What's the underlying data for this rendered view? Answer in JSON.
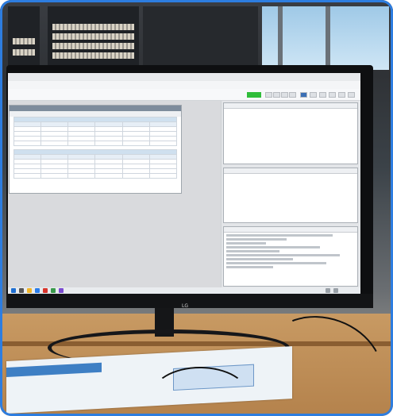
{
  "monitor": {
    "brand": "LG"
  },
  "app": {
    "menu": [
      "",
      "",
      ""
    ],
    "panel": {
      "table1": {
        "caption": "",
        "headers": [
          "",
          "",
          "",
          "",
          "",
          ""
        ],
        "rows": [
          [
            "",
            "",
            "",
            "",
            "",
            ""
          ],
          [
            "",
            "",
            "",
            "",
            "",
            ""
          ],
          [
            "",
            "",
            "",
            "",
            "",
            ""
          ],
          [
            "",
            "",
            "",
            "",
            "",
            ""
          ]
        ]
      },
      "table2": {
        "caption": "",
        "headers": [
          "",
          "",
          "",
          "",
          "",
          ""
        ],
        "rows": [
          [
            "",
            "",
            "",
            "",
            "",
            ""
          ],
          [
            "",
            "",
            "",
            "",
            "",
            ""
          ],
          [
            "",
            "",
            "",
            "",
            "",
            ""
          ],
          [
            "",
            "",
            "",
            "",
            "",
            ""
          ]
        ]
      }
    }
  },
  "colors": {
    "frame_border": "#2d7de0",
    "status_green": "#2fbd3a",
    "panel_header": "#7e8c9c"
  }
}
